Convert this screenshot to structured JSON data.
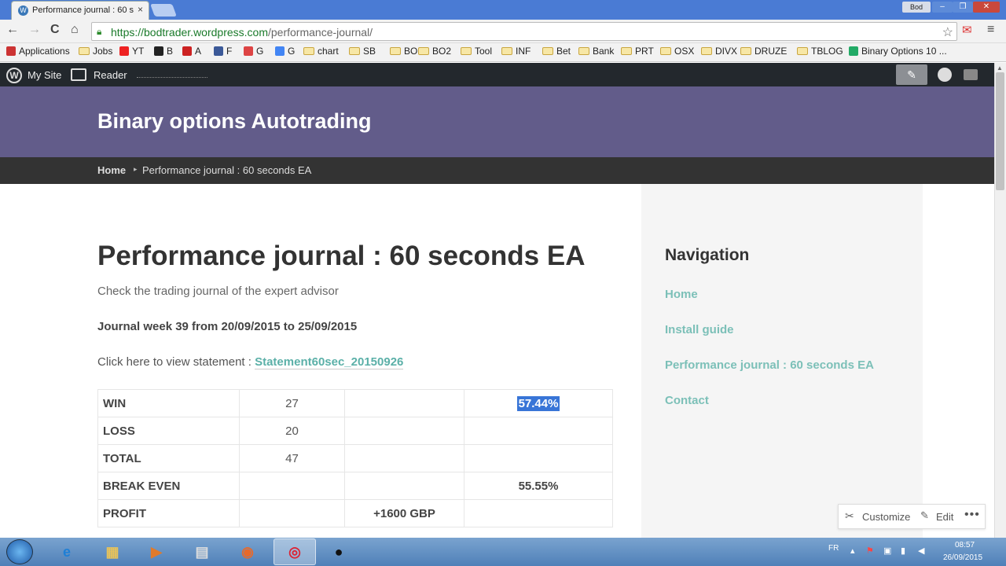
{
  "browser": {
    "tab_title": "Performance journal : 60 s",
    "tab_close": "×",
    "user_label": "Bod",
    "win_min": "–",
    "win_max": "❐",
    "win_close": "✕",
    "url_host": "https://bodtrader.wordpress.com",
    "url_path": "/performance-journal/",
    "nav_back": "←",
    "nav_forward": "→",
    "nav_reload": "C",
    "nav_home": "⌂",
    "star": "☆",
    "menu": "≡"
  },
  "bookmarks": [
    {
      "label": "Applications",
      "icon": "apps-grid-icon"
    },
    {
      "label": "Jobs",
      "icon": "folder-icon"
    },
    {
      "label": "YT",
      "icon": "youtube-icon"
    },
    {
      "label": "B",
      "icon": "bbc-icon"
    },
    {
      "label": "A",
      "icon": "a-icon"
    },
    {
      "label": "F",
      "icon": "facebook-icon"
    },
    {
      "label": "G",
      "icon": "gmail-icon"
    },
    {
      "label": "G",
      "icon": "google-icon"
    },
    {
      "label": "chart",
      "icon": "folder-icon"
    },
    {
      "label": "SB",
      "icon": "folder-icon"
    },
    {
      "label": "BO",
      "icon": "folder-icon"
    },
    {
      "label": "BO2",
      "icon": "folder-icon"
    },
    {
      "label": "Tool",
      "icon": "folder-icon"
    },
    {
      "label": "INF",
      "icon": "folder-icon"
    },
    {
      "label": "Bet",
      "icon": "folder-icon"
    },
    {
      "label": "Bank",
      "icon": "folder-icon"
    },
    {
      "label": "PRT",
      "icon": "folder-icon"
    },
    {
      "label": "OSX",
      "icon": "folder-icon"
    },
    {
      "label": "DIVX",
      "icon": "folder-icon"
    },
    {
      "label": "DRUZE",
      "icon": "folder-icon"
    },
    {
      "label": "TBLOG",
      "icon": "folder-icon"
    },
    {
      "label": "Binary Options 10 ...",
      "icon": "site-icon"
    }
  ],
  "wpbar": {
    "my_site": "My Site",
    "reader": "Reader",
    "write_icon": "✎"
  },
  "site": {
    "title": "Binary options Autotrading",
    "breadcrumb_home": "Home",
    "breadcrumb_sep": "▸",
    "breadcrumb_current": "Performance journal : 60 seconds EA"
  },
  "page": {
    "title": "Performance journal : 60 seconds EA",
    "intro": "Check the trading journal of the expert advisor",
    "week": "Journal week 39 from 20/09/2015 to 25/09/2015",
    "statement_prefix": "Click here to view statement : ",
    "statement_link": "Statement60sec_20150926"
  },
  "journal_table": {
    "rows": [
      {
        "label": "WIN",
        "c2": "27",
        "c3": "",
        "c4": "57.44%"
      },
      {
        "label": "LOSS",
        "c2": "20",
        "c3": "",
        "c4": ""
      },
      {
        "label": "TOTAL",
        "c2": "47",
        "c3": "",
        "c4": ""
      },
      {
        "label": "BREAK EVEN",
        "c2": "",
        "c3": "",
        "c4": "55.55%"
      },
      {
        "label": "PROFIT",
        "c2": "",
        "c3": "+1600 GBP",
        "c4": ""
      }
    ]
  },
  "sidebar": {
    "title": "Navigation",
    "links": [
      "Home",
      "Install guide",
      "Performance journal : 60 seconds EA",
      "Contact"
    ]
  },
  "customize_bar": {
    "customize": "Customize",
    "edit": "Edit",
    "more": "•••"
  },
  "taskbar": {
    "lang": "FR",
    "time": "08:57",
    "date": "26/09/2015"
  },
  "colors": {
    "header_bg": "#625c8a",
    "link": "#7cc0b8",
    "selection": "#3875d7"
  }
}
